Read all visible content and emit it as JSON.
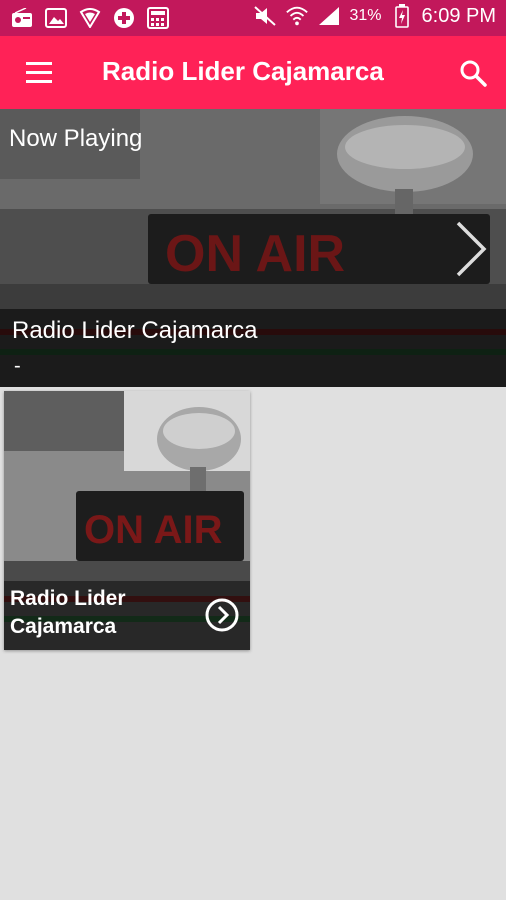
{
  "status_bar": {
    "icons": [
      "radio-icon",
      "image-icon",
      "shield-icon",
      "medical-cross-icon",
      "calculator-icon"
    ],
    "right_icons": [
      "mute-icon",
      "wifi-icon",
      "signal-icon",
      "battery-icon"
    ],
    "battery": "31%",
    "time": "6:09 PM"
  },
  "toolbar": {
    "title": "Radio Lider Cajamarca",
    "menu_icon": "menu-icon",
    "search_icon": "search-icon",
    "color": "#ff2257"
  },
  "now_playing": {
    "heading": "Now Playing",
    "station": "Radio Lider Cajamarca",
    "subtitle": "-",
    "sign_text": "ON AIR"
  },
  "stations": [
    {
      "name": "Radio Lider Cajamarca",
      "sign_text": "ON AIR"
    }
  ]
}
